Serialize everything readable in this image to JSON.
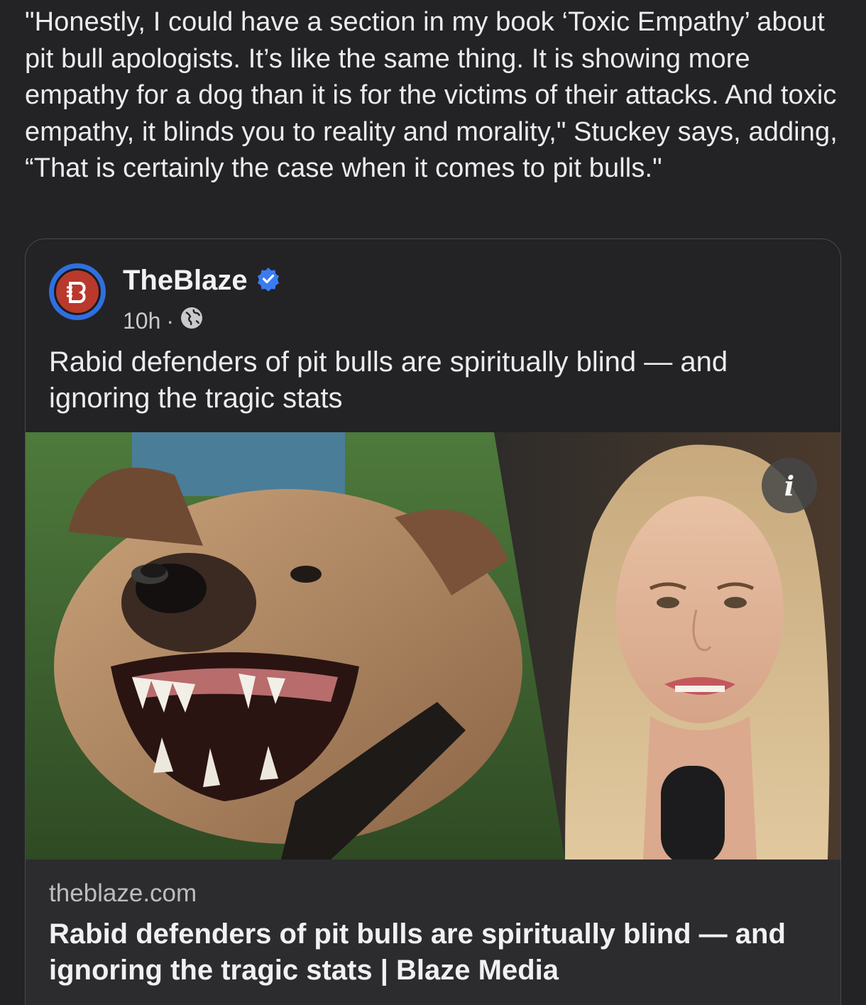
{
  "quote": {
    "text": "\"Honestly, I could have a section in my book ‘Toxic Empathy’ about pit bull apologists. It’s like the same thing. It is showing more empathy for a dog than it is for the victims of their attacks. And toxic empathy, it blinds you to reality and morality,\" Stuckey says, adding, “That is certainly the case when it comes to pit bulls.\""
  },
  "post": {
    "author": "TheBlaze",
    "verified_icon": "verified-badge-icon",
    "time": "10h",
    "separator": "·",
    "audience_icon": "globe-icon",
    "text": "Rabid defenders of pit bulls are spiritually blind — and ignoring the tragic stats",
    "info_label": "i"
  },
  "link_preview": {
    "domain": "theblaze.com",
    "title": "Rabid defenders of pit bulls are spiritually blind — and ignoring the tragic stats | Blaze Media"
  },
  "colors": {
    "background": "#232325",
    "link_block": "#2c2c2e",
    "verified_blue": "#3a7cf0",
    "brand_red": "#b9392c"
  }
}
